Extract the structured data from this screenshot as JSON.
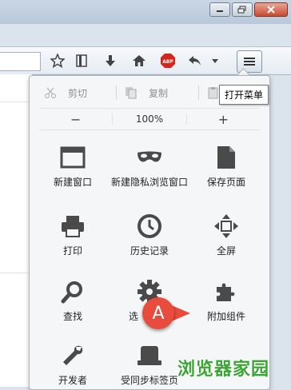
{
  "tooltip": "打开菜单",
  "edit": {
    "cut": "剪切",
    "copy": "复制",
    "paste": "粘"
  },
  "zoom": {
    "minus": "−",
    "level": "100%",
    "plus": "+"
  },
  "items": [
    {
      "label": "新建窗口",
      "icon": "new-window-icon"
    },
    {
      "label": "新建隐私浏览窗口",
      "icon": "private-mask-icon"
    },
    {
      "label": "保存页面",
      "icon": "save-page-icon"
    },
    {
      "label": "打印",
      "icon": "printer-icon"
    },
    {
      "label": "历史记录",
      "icon": "history-clock-icon"
    },
    {
      "label": "全屏",
      "icon": "fullscreen-icon"
    },
    {
      "label": "查找",
      "icon": "search-magnifier-icon"
    },
    {
      "label": "选",
      "icon": "options-gear-icon"
    },
    {
      "label": "附加组件",
      "icon": "addons-puzzle-icon"
    },
    {
      "label": "开发者",
      "icon": "developer-wrench-icon"
    },
    {
      "label": "受同步标签页",
      "icon": "sync-tabs-icon"
    }
  ],
  "marker_label": "A",
  "watermark": "浏览器家园",
  "colors": {
    "accent": "#e74c3c",
    "watermark": "#3aa534",
    "icon": "#4a4a4a"
  }
}
